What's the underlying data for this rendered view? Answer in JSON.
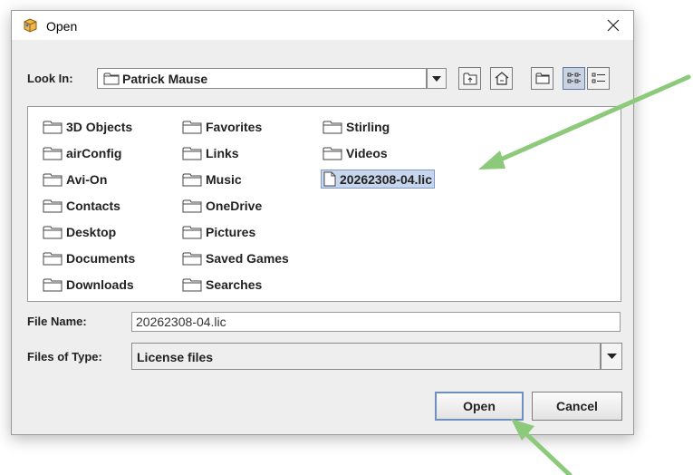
{
  "dialog": {
    "title": "Open",
    "look_in_label": "Look In:",
    "look_in_value": "Patrick Mause",
    "toolbar": [
      "up-one-level",
      "home",
      "new-folder",
      "list-view",
      "details-view"
    ],
    "files": [
      {
        "name": "3D Objects",
        "type": "folder"
      },
      {
        "name": "airConfig",
        "type": "folder"
      },
      {
        "name": "Avi-On",
        "type": "folder"
      },
      {
        "name": "Contacts",
        "type": "folder"
      },
      {
        "name": "Desktop",
        "type": "folder"
      },
      {
        "name": "Documents",
        "type": "folder"
      },
      {
        "name": "Downloads",
        "type": "folder"
      },
      {
        "name": "Favorites",
        "type": "folder"
      },
      {
        "name": "Links",
        "type": "folder"
      },
      {
        "name": "Music",
        "type": "folder"
      },
      {
        "name": "OneDrive",
        "type": "folder"
      },
      {
        "name": "Pictures",
        "type": "folder"
      },
      {
        "name": "Saved Games",
        "type": "folder"
      },
      {
        "name": "Searches",
        "type": "folder"
      },
      {
        "name": "Stirling",
        "type": "folder"
      },
      {
        "name": "Videos",
        "type": "folder"
      },
      {
        "name": "20262308-04.lic",
        "type": "file",
        "selected": true
      }
    ],
    "file_name_label": "File Name:",
    "file_name_value": "20262308-04.lic",
    "files_of_type_label": "Files of Type:",
    "files_of_type_value": "License files",
    "open_button": "Open",
    "cancel_button": "Cancel"
  },
  "colors": {
    "arrow": "#8cc97a",
    "selection": "#c7d6ec",
    "dialog_bg": "#eeeeee"
  }
}
